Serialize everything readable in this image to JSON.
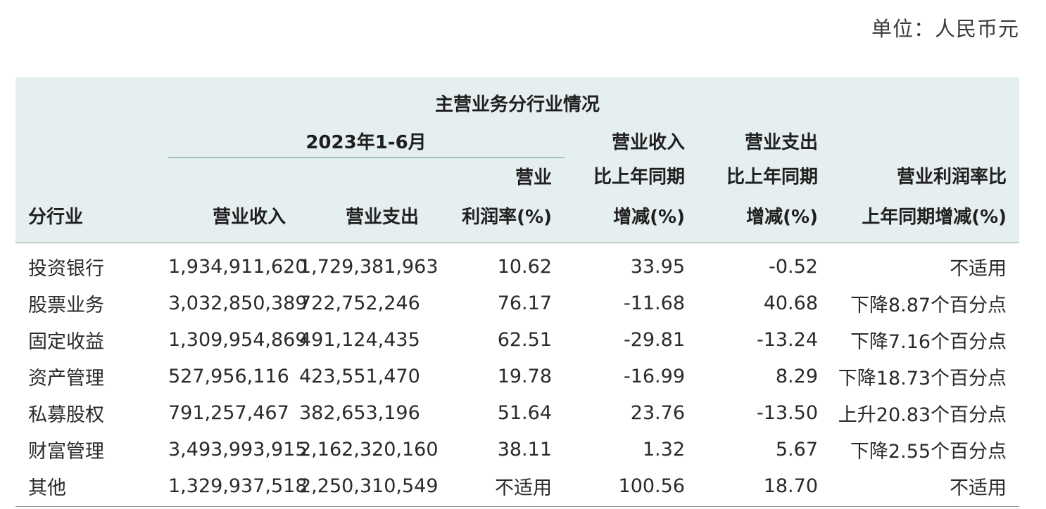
{
  "unit_label": "单位：人民币元",
  "table": {
    "caption": "主营业务分行业情况",
    "period": "2023年1-6月",
    "headers": {
      "industry": "分行业",
      "revenue": "营业收入",
      "expense": "营业支出",
      "margin_line1": "营业",
      "margin_line2": "利润率(%)",
      "rev_change_line1": "营业收入",
      "rev_change_line2": "比上年同期",
      "rev_change_line3": "增减(%)",
      "exp_change_line1": "营业支出",
      "exp_change_line2": "比上年同期",
      "exp_change_line3": "增减(%)",
      "margin_change_line1": "营业利润率比",
      "margin_change_line2": "上年同期增减(%)"
    },
    "rows": [
      {
        "industry": "投资银行",
        "revenue": "1,934,911,620",
        "expense": "1,729,381,963",
        "margin": "10.62",
        "rev_change": "33.95",
        "exp_change": "-0.52",
        "margin_change": "不适用"
      },
      {
        "industry": "股票业务",
        "revenue": "3,032,850,389",
        "expense": "722,752,246",
        "margin": "76.17",
        "rev_change": "-11.68",
        "exp_change": "40.68",
        "margin_change": "下降8.87个百分点"
      },
      {
        "industry": "固定收益",
        "revenue": "1,309,954,869",
        "expense": "491,124,435",
        "margin": "62.51",
        "rev_change": "-29.81",
        "exp_change": "-13.24",
        "margin_change": "下降7.16个百分点"
      },
      {
        "industry": "资产管理",
        "revenue": "527,956,116",
        "expense": "423,551,470",
        "margin": "19.78",
        "rev_change": "-16.99",
        "exp_change": "8.29",
        "margin_change": "下降18.73个百分点"
      },
      {
        "industry": "私募股权",
        "revenue": "791,257,467",
        "expense": "382,653,196",
        "margin": "51.64",
        "rev_change": "23.76",
        "exp_change": "-13.50",
        "margin_change": "上升20.83个百分点"
      },
      {
        "industry": "财富管理",
        "revenue": "3,493,993,915",
        "expense": "2,162,320,160",
        "margin": "38.11",
        "rev_change": "1.32",
        "exp_change": "5.67",
        "margin_change": "下降2.55个百分点"
      },
      {
        "industry": "其他",
        "revenue": "1,329,937,518",
        "expense": "2,250,310,549",
        "margin": "不适用",
        "rev_change": "100.56",
        "exp_change": "18.70",
        "margin_change": "不适用"
      }
    ]
  }
}
